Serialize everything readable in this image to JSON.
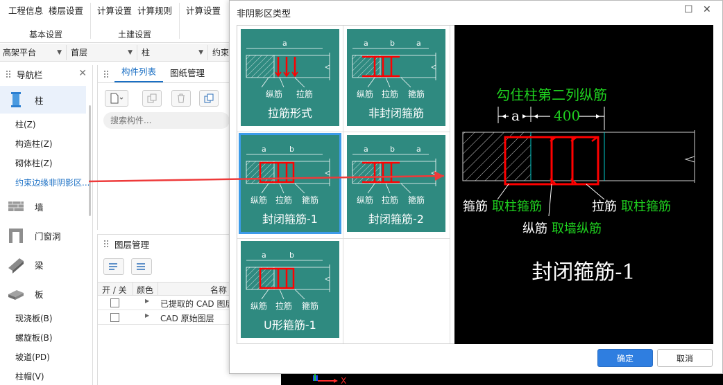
{
  "ribbon": {
    "items": [
      "工程信息",
      "楼层设置",
      "计算设置",
      "计算规则",
      "计算设置"
    ],
    "groups": [
      "基本设置",
      "土建设置"
    ]
  },
  "filters": {
    "floor_type": "高架平台",
    "floor": "首层",
    "category": "柱",
    "sub": "约束"
  },
  "nav": {
    "title": "导航栏",
    "categories": [
      {
        "label": "柱",
        "icon": "column-icon"
      },
      {
        "label": "墙",
        "icon": "wall-icon"
      },
      {
        "label": "门窗洞",
        "icon": "door-window-icon"
      },
      {
        "label": "梁",
        "icon": "beam-icon"
      },
      {
        "label": "板",
        "icon": "slab-icon"
      }
    ],
    "column_items": [
      "柱(Z)",
      "构造柱(Z)",
      "砌体柱(Z)",
      "约束边缘非阴影区..."
    ],
    "slab_items": [
      "现浇板(B)",
      "螺旋板(B)",
      "坡道(PD)",
      "柱帽(V)"
    ]
  },
  "component_list": {
    "tabs": [
      "构件列表",
      "图纸管理"
    ],
    "search_placeholder": "搜索构件..."
  },
  "layer_panel": {
    "title": "图层管理",
    "columns": [
      "开 / 关",
      "颜色",
      "名称"
    ],
    "rows": [
      "已提取的 CAD 图层",
      "CAD 原始图层"
    ]
  },
  "dialog": {
    "title": "非阴影区类型",
    "cards": [
      {
        "label": "拉筋形式",
        "dims": [
          "a"
        ],
        "tags": [
          "纵筋",
          "拉筋"
        ]
      },
      {
        "label": "非封闭箍筋",
        "dims": [
          "a",
          "b",
          "a"
        ],
        "tags": [
          "纵筋",
          "拉筋",
          "箍筋"
        ]
      },
      {
        "label": "封闭箍筋-1",
        "dims": [
          "a",
          "b"
        ],
        "tags": [
          "纵筋",
          "拉筋",
          "箍筋"
        ]
      },
      {
        "label": "封闭箍筋-2",
        "dims": [
          "a",
          "b",
          "a"
        ],
        "tags": [
          "纵筋",
          "拉筋",
          "箍筋"
        ]
      },
      {
        "label": "U形箍筋-1",
        "dims": [
          "a",
          "b"
        ],
        "tags": [
          "纵筋",
          "拉筋",
          "箍筋"
        ]
      }
    ],
    "preview": {
      "top_label": "勾住柱第二列纵筋",
      "dim_a": "a",
      "dim_value": "400",
      "stirrup_white": "箍筋",
      "stirrup_green": "取柱箍筋",
      "tie_white": "拉筋",
      "tie_green": "取柱箍筋",
      "long_white": "纵筋",
      "long_green": "取墙纵筋",
      "title": "封闭箍筋-1"
    },
    "ok_label": "确定",
    "cancel_label": "取消",
    "selected_card": "封闭箍筋-1"
  },
  "colors": {
    "card_bg": "#2f8a80",
    "selection": "#3d9be9",
    "rebar_red": "#ff0000",
    "annotation_green": "#1fd11f",
    "primary_button": "#2f7ee0"
  },
  "cad_axis": "X"
}
